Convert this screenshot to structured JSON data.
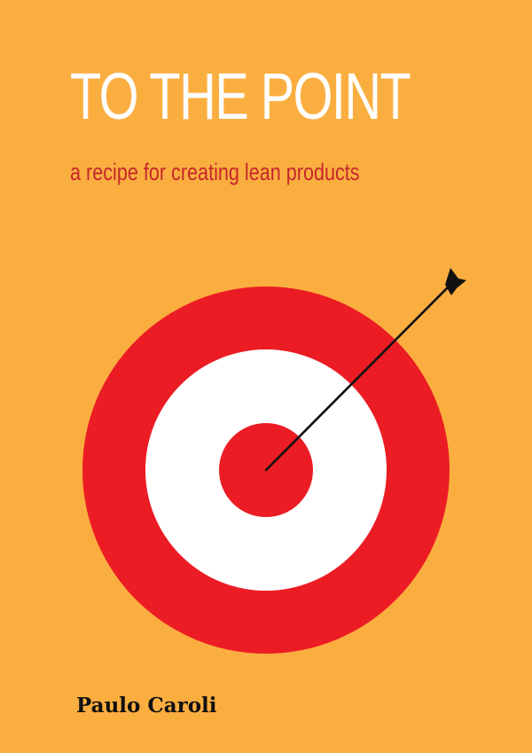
{
  "cover": {
    "title": "TO THE POINT",
    "subtitle": "a recipe for creating lean products",
    "author": "Paulo Caroli"
  },
  "colors": {
    "background": "#fbae40",
    "title": "#ffffff",
    "subtitle": "#c5282b",
    "target_red": "#ec1c24",
    "target_white": "#ffffff",
    "arrow": "#111111",
    "author": "#111111"
  },
  "graphic": {
    "target_icon": "bullseye-target-icon",
    "arrow_icon": "arrow-icon"
  }
}
